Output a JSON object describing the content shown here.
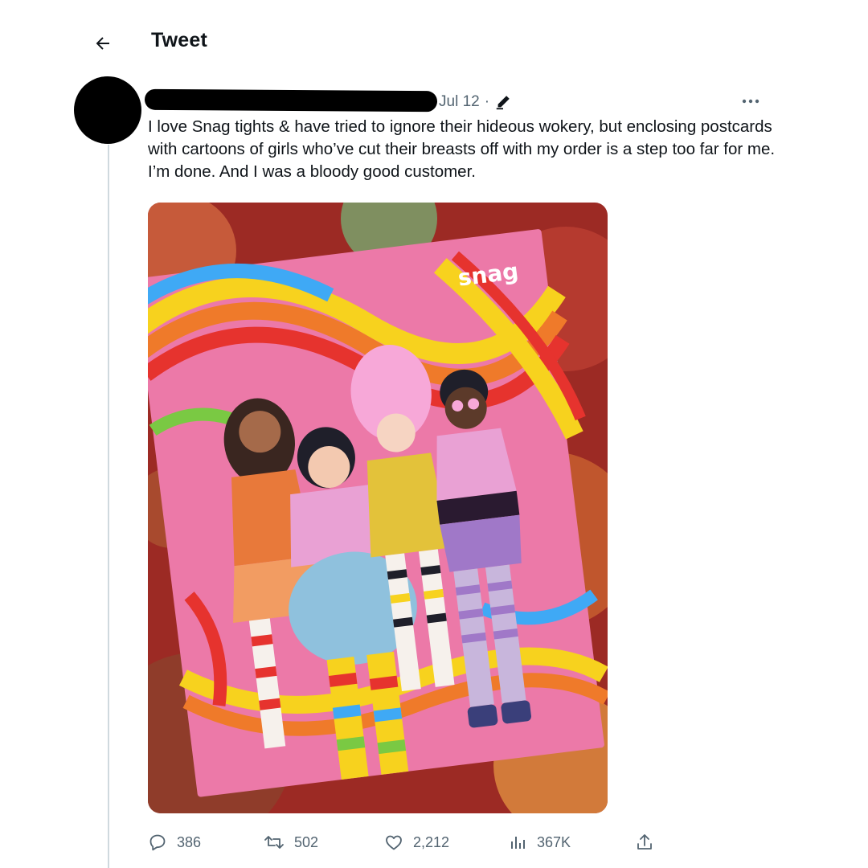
{
  "header": {
    "title": "Tweet",
    "back_icon": "back-arrow-icon"
  },
  "tweet": {
    "author_name_redacted": true,
    "date": "Jul 12",
    "separator": "·",
    "edited_icon": "pencil-icon",
    "more_icon": "more-dots-icon",
    "text": "I love Snag tights & have tried to ignore their hideous wokery, but enclosing postcards with cartoons of girls who’ve cut their breasts off with my order is a step too far for me. I’m done. And I was a bloody good customer.",
    "media": {
      "brand_text": "snag",
      "description_icon": "photo"
    },
    "actions": {
      "replies": "386",
      "retweets": "502",
      "likes": "2,212",
      "views": "367K"
    }
  },
  "colors": {
    "secondary_text": "#536471",
    "primary_text": "#0f1419",
    "thread_line": "#cfd9de",
    "postcard_pink": "#ec79a8"
  }
}
